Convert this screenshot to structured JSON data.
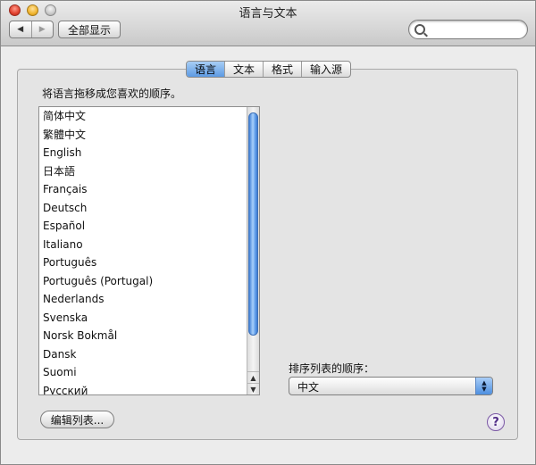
{
  "window": {
    "title": "语言与文本"
  },
  "toolbar": {
    "back_glyph": "◀",
    "forward_glyph": "▶",
    "show_all_label": "全部显示",
    "search": {
      "value": "",
      "placeholder": ""
    }
  },
  "tabs": [
    {
      "label": "语言",
      "active": true
    },
    {
      "label": "文本",
      "active": false
    },
    {
      "label": "格式",
      "active": false
    },
    {
      "label": "输入源",
      "active": false
    }
  ],
  "main": {
    "instruction": "将语言拖移成您喜欢的顺序。",
    "languages": [
      "简体中文",
      "繁體中文",
      "English",
      "日本語",
      "Français",
      "Deutsch",
      "Español",
      "Italiano",
      "Português",
      "Português (Portugal)",
      "Nederlands",
      "Svenska",
      "Norsk Bokmål",
      "Dansk",
      "Suomi",
      "Русский"
    ],
    "sort": {
      "label": "排序列表的顺序：",
      "value": "中文"
    },
    "edit_list_label": "编辑列表...",
    "help_glyph": "?"
  },
  "colors": {
    "accent_blue": "#5d9ae4",
    "help_purple": "#4f2a86"
  }
}
